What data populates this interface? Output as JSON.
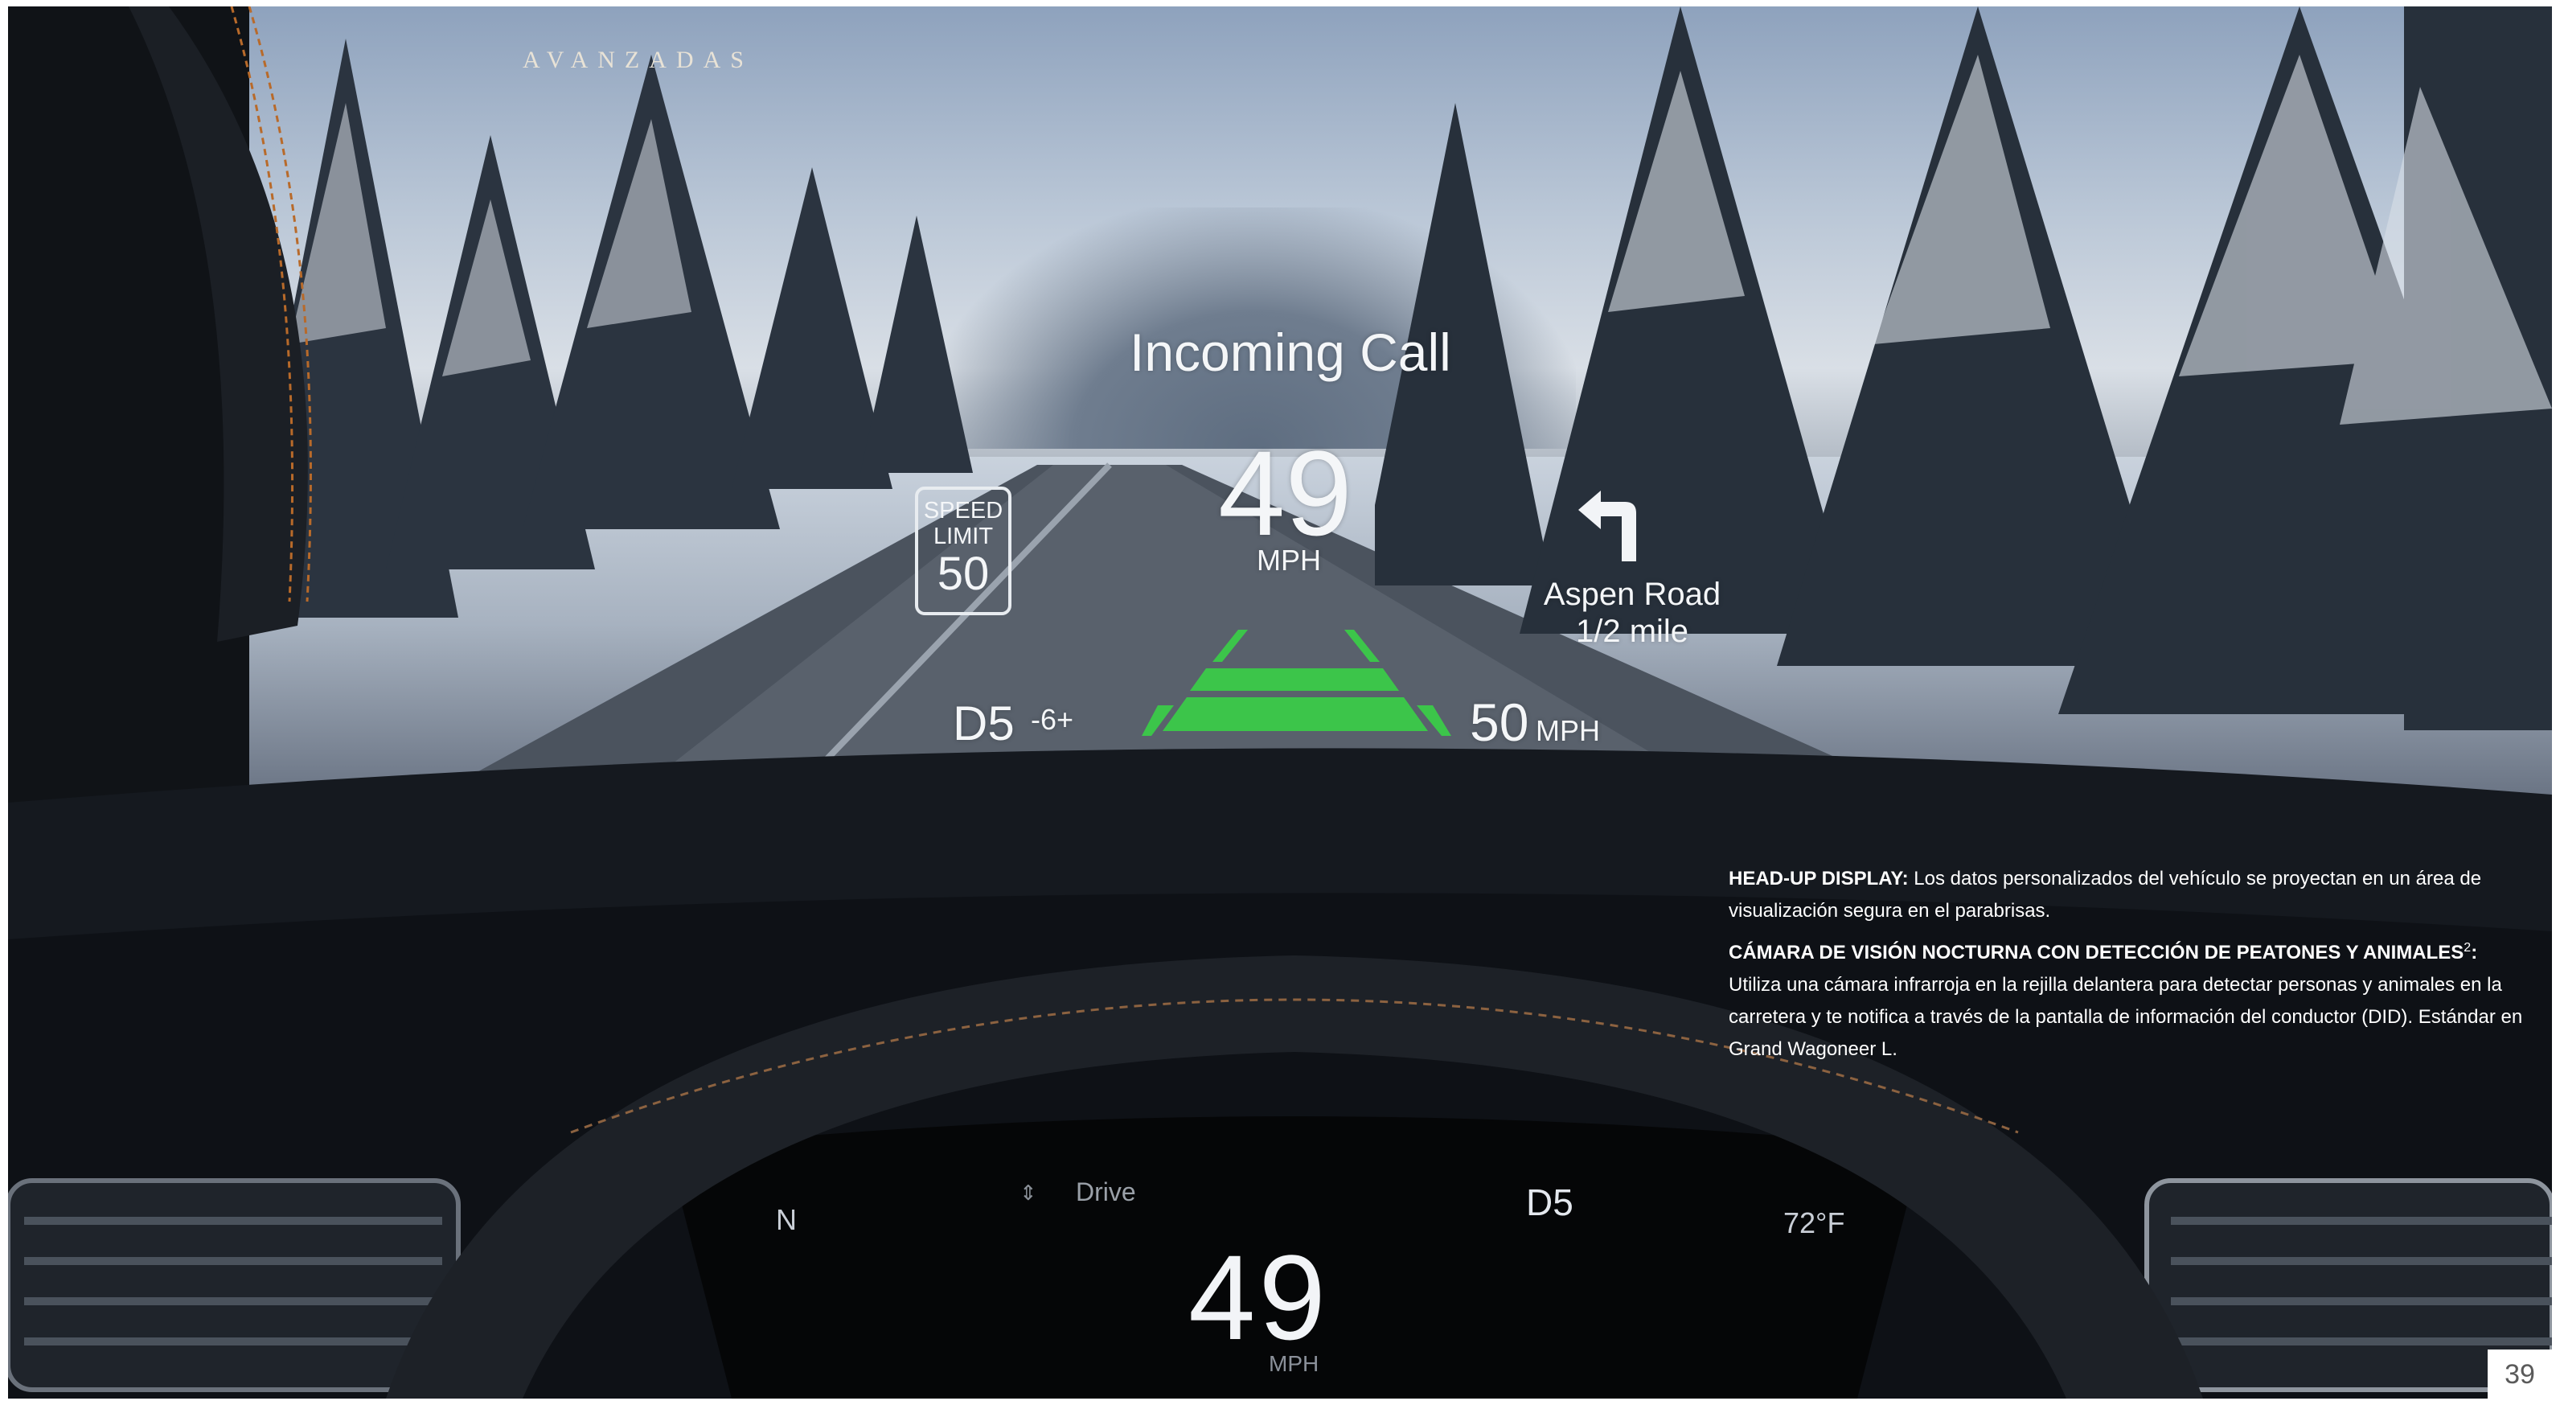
{
  "section": {
    "label": "AVANZADAS"
  },
  "hud": {
    "title": "Incoming Call",
    "speed": "49",
    "speed_unit": "MPH",
    "speed_limit": {
      "line1": "SPEED",
      "line2": "LIMIT",
      "value": "50"
    },
    "navigation": {
      "street": "Aspen Road",
      "distance": "1/2 mile",
      "icon": "turn-left-arrow-icon"
    },
    "gear": "D5",
    "gear_adjust": "-6+",
    "set_speed": "50",
    "set_speed_unit": "MPH",
    "lane_icon": "lane-keep-icon",
    "lane_color": "#3cc54a"
  },
  "cluster": {
    "compass": "N",
    "drive_label": "Drive",
    "gear": "D5",
    "temperature": "72°F",
    "speed": "49",
    "speed_unit": "MPH"
  },
  "caption": {
    "p1_heading": "HEAD-UP DISPLAY:",
    "p1_text": " Los datos personalizados del vehículo se proyectan en un área de visualización segura en el parabrisas.",
    "p2_heading": "CÁMARA DE VISIÓN NOCTURNA CON DETECCIÓN DE PEATONES Y ANIMALES",
    "p2_sup": "2",
    "p2_colon": ":",
    "p2_text": "Utiliza una cámara infrarroja en la rejilla delantera para detectar personas y animales en la carretera y te notifica a través de la pantalla de información del conductor (DID). Estándar en Grand Wagoneer L."
  },
  "page_number": "39"
}
